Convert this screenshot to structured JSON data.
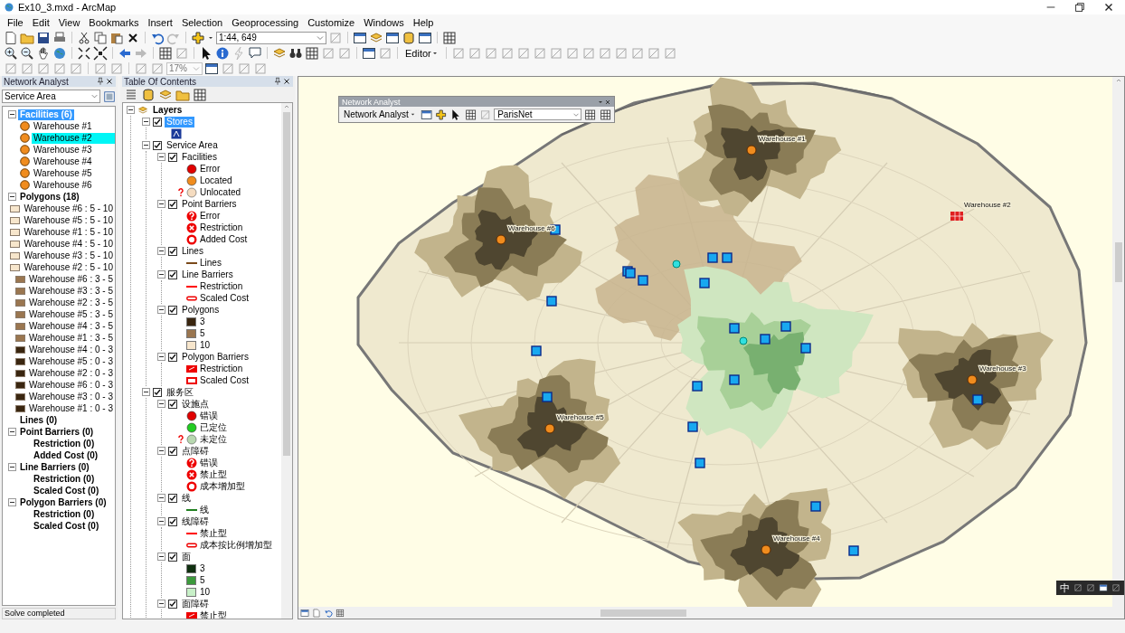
{
  "window": {
    "title": "Ex10_3.mxd - ArcMap"
  },
  "menu": [
    "File",
    "Edit",
    "View",
    "Bookmarks",
    "Insert",
    "Selection",
    "Geoprocessing",
    "Customize",
    "Windows",
    "Help"
  ],
  "toolbar": {
    "scale": "1:44, 649",
    "editor": "Editor",
    "zoom": "17%"
  },
  "network_analyst": {
    "title": "Network Analyst",
    "analysis": "Service Area",
    "groups": [
      {
        "label": "Facilities (6)",
        "expanded": true,
        "selected": true,
        "items": [
          {
            "kind": "facility",
            "label": "Warehouse #1",
            "selected": false
          },
          {
            "kind": "facility",
            "label": "Warehouse #2",
            "selected": true
          },
          {
            "kind": "facility",
            "label": "Warehouse #3",
            "selected": false
          },
          {
            "kind": "facility",
            "label": "Warehouse #4",
            "selected": false
          },
          {
            "kind": "facility",
            "label": "Warehouse #5",
            "selected": false
          },
          {
            "kind": "facility",
            "label": "Warehouse #6",
            "selected": false
          }
        ]
      },
      {
        "label": "Polygons (18)",
        "expanded": true,
        "selected": false,
        "items": [
          {
            "kind": "polygon",
            "label": "Warehouse #6 : 5 - 10",
            "color": "#f7e6cc",
            "selected": false
          },
          {
            "kind": "polygon",
            "label": "Warehouse #5 : 5 - 10",
            "color": "#f7e6cc",
            "selected": false
          },
          {
            "kind": "polygon",
            "label": "Warehouse #1 : 5 - 10",
            "color": "#f7e6cc",
            "selected": false
          },
          {
            "kind": "polygon",
            "label": "Warehouse #4 : 5 - 10",
            "color": "#f7e6cc",
            "selected": false
          },
          {
            "kind": "polygon",
            "label": "Warehouse #3 : 5 - 10",
            "color": "#f7e6cc",
            "selected": false
          },
          {
            "kind": "polygon",
            "label": "Warehouse #2 : 5 - 10",
            "color": "#f7e6cc",
            "selected": false
          },
          {
            "kind": "polygon",
            "label": "Warehouse #6 : 3 - 5",
            "color": "#9a7650",
            "selected": false
          },
          {
            "kind": "polygon",
            "label": "Warehouse #3 : 3 - 5",
            "color": "#9a7650",
            "selected": false
          },
          {
            "kind": "polygon",
            "label": "Warehouse #2 : 3 - 5",
            "color": "#9a7650",
            "selected": false
          },
          {
            "kind": "polygon",
            "label": "Warehouse #5 : 3 - 5",
            "color": "#9a7650",
            "selected": false
          },
          {
            "kind": "polygon",
            "label": "Warehouse #4 : 3 - 5",
            "color": "#9a7650",
            "selected": false
          },
          {
            "kind": "polygon",
            "label": "Warehouse #1 : 3 - 5",
            "color": "#9a7650",
            "selected": false
          },
          {
            "kind": "polygon",
            "label": "Warehouse #4 : 0 - 3",
            "color": "#3a2610",
            "selected": false
          },
          {
            "kind": "polygon",
            "label": "Warehouse #5 : 0 - 3",
            "color": "#3a2610",
            "selected": false
          },
          {
            "kind": "polygon",
            "label": "Warehouse #2 : 0 - 3",
            "color": "#3a2610",
            "selected": false
          },
          {
            "kind": "polygon",
            "label": "Warehouse #6 : 0 - 3",
            "color": "#3a2610",
            "selected": false
          },
          {
            "kind": "polygon",
            "label": "Warehouse #3 : 0 - 3",
            "color": "#3a2610",
            "selected": false
          },
          {
            "kind": "polygon",
            "label": "Warehouse #1 : 0 - 3",
            "color": "#3a2610",
            "selected": false
          }
        ]
      },
      {
        "label": "Lines (0)",
        "selected": false
      },
      {
        "label": "Point Barriers (0)",
        "expanded": true,
        "selected": false,
        "items": [
          {
            "kind": "class",
            "label": "Restriction (0)",
            "selected": false
          },
          {
            "kind": "class",
            "label": "Added Cost (0)",
            "selected": false
          }
        ]
      },
      {
        "label": "Line Barriers (0)",
        "expanded": true,
        "selected": false,
        "items": [
          {
            "kind": "class",
            "label": "Restriction (0)",
            "selected": false
          },
          {
            "kind": "class",
            "label": "Scaled Cost (0)",
            "selected": false
          }
        ]
      },
      {
        "label": "Polygon Barriers (0)",
        "expanded": true,
        "selected": false,
        "items": [
          {
            "kind": "class",
            "label": "Restriction (0)",
            "selected": false
          },
          {
            "kind": "class",
            "label": "Scaled Cost (0)",
            "selected": false
          }
        ]
      }
    ],
    "status": "Solve completed"
  },
  "table_of_contents": {
    "title": "Table Of Contents",
    "layers": [
      {
        "kind": "frame",
        "label": "Layers",
        "expanded": true,
        "children": [
          {
            "kind": "layer",
            "label": "Stores",
            "checked": true,
            "selected": true,
            "expanded": true,
            "children": [
              {
                "kind": "store"
              }
            ]
          },
          {
            "kind": "layer",
            "label": "Service Area",
            "checked": true,
            "selected": false,
            "expanded": true,
            "children": [
              {
                "kind": "layer",
                "label": "Facilities",
                "checked": true,
                "selected": false,
                "expanded": true,
                "children": [
                  {
                    "kind": "dot",
                    "label": "Error",
                    "color": "#e00000"
                  },
                  {
                    "kind": "dot",
                    "label": "Located",
                    "color": "#f08c1e"
                  },
                  {
                    "kind": "question-dot",
                    "label": "Unlocated",
                    "color": "#f5dcc0"
                  }
                ]
              },
              {
                "kind": "layer",
                "label": "Point Barriers",
                "checked": true,
                "selected": false,
                "expanded": true,
                "children": [
                  {
                    "kind": "question-mark",
                    "label": "Error"
                  },
                  {
                    "kind": "x-circle",
                    "label": "Restriction"
                  },
                  {
                    "kind": "ring",
                    "label": "Added Cost"
                  }
                ]
              },
              {
                "kind": "layer",
                "label": "Lines",
                "checked": true,
                "selected": false,
                "expanded": true,
                "children": [
                  {
                    "kind": "line",
                    "label": "Lines",
                    "color": "#7a4a1a"
                  }
                ]
              },
              {
                "kind": "layer",
                "label": "Line Barriers",
                "checked": true,
                "selected": false,
                "expanded": true,
                "children": [
                  {
                    "kind": "line",
                    "label": "Restriction",
                    "color": "#ff0000"
                  },
                  {
                    "kind": "hollow-line",
                    "label": "Scaled Cost"
                  }
                ]
              },
              {
                "kind": "layer",
                "label": "Polygons",
                "checked": true,
                "selected": false,
                "expanded": true,
                "children": [
                  {
                    "kind": "swatch",
                    "label": "3",
                    "color": "#3a2610"
                  },
                  {
                    "kind": "swatch",
                    "label": "5",
                    "color": "#9a7650"
                  },
                  {
                    "kind": "swatch",
                    "label": "10",
                    "color": "#f7e6cc"
                  }
                ]
              },
              {
                "kind": "layer",
                "label": "Polygon Barriers",
                "checked": true,
                "selected": false,
                "expanded": true,
                "children": [
                  {
                    "kind": "barrier-fill",
                    "label": "Restriction"
                  },
                  {
                    "kind": "barrier-scaled",
                    "label": "Scaled Cost"
                  }
                ]
              }
            ]
          },
          {
            "kind": "layer",
            "label": "服务区",
            "checked": true,
            "selected": false,
            "expanded": true,
            "children": [
              {
                "kind": "layer",
                "label": "设施点",
                "checked": true,
                "selected": false,
                "expanded": true,
                "children": [
                  {
                    "kind": "dot",
                    "label": "错误",
                    "color": "#e00000"
                  },
                  {
                    "kind": "dot",
                    "label": "已定位",
                    "color": "#22cc22"
                  },
                  {
                    "kind": "question-dot",
                    "label": "未定位",
                    "color": "#b8d8b0"
                  }
                ]
              },
              {
                "kind": "layer",
                "label": "点障碍",
                "checked": true,
                "selected": false,
                "expanded": true,
                "children": [
                  {
                    "kind": "question-mark",
                    "label": "错误"
                  },
                  {
                    "kind": "x-circle",
                    "label": "禁止型"
                  },
                  {
                    "kind": "ring",
                    "label": "成本增加型"
                  }
                ]
              },
              {
                "kind": "layer",
                "label": "线",
                "checked": true,
                "selected": false,
                "expanded": true,
                "children": [
                  {
                    "kind": "line",
                    "label": "线",
                    "color": "#208020"
                  }
                ]
              },
              {
                "kind": "layer",
                "label": "线障碍",
                "checked": true,
                "selected": false,
                "expanded": true,
                "children": [
                  {
                    "kind": "line",
                    "label": "禁止型",
                    "color": "#ff0000"
                  },
                  {
                    "kind": "hollow-line",
                    "label": "成本按比例增加型"
                  }
                ]
              },
              {
                "kind": "layer",
                "label": "面",
                "checked": true,
                "selected": false,
                "expanded": true,
                "children": [
                  {
                    "kind": "swatch",
                    "label": "3",
                    "color": "#103010"
                  },
                  {
                    "kind": "swatch",
                    "label": "5",
                    "color": "#3c9a3c"
                  },
                  {
                    "kind": "swatch",
                    "label": "10",
                    "color": "#c8f0c8"
                  }
                ]
              },
              {
                "kind": "layer",
                "label": "面障碍",
                "checked": true,
                "selected": false,
                "expanded": true,
                "children": [
                  {
                    "kind": "barrier-fill",
                    "label": "禁止型"
                  }
                ]
              }
            ]
          }
        ]
      }
    ]
  },
  "map": {
    "network_analyst_toolbar": {
      "title": "Network Analyst",
      "menu": "Network Analyst",
      "network": "ParisNet"
    },
    "facilities": [
      {
        "label": "Warehouse #1",
        "selected": false
      },
      {
        "label": "Warehouse #2",
        "selected": true
      },
      {
        "label": "Warehouse #3",
        "selected": false
      },
      {
        "label": "Warehouse #4",
        "selected": false
      },
      {
        "label": "Warehouse #5",
        "selected": false
      },
      {
        "label": "Warehouse #6",
        "selected": false
      }
    ],
    "ime": "中"
  }
}
